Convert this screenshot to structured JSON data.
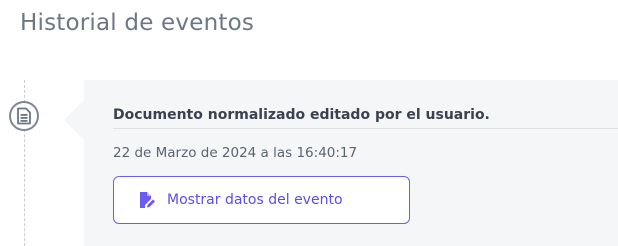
{
  "page": {
    "title": "Historial de eventos"
  },
  "events": [
    {
      "icon": "document-icon",
      "title": "Documento normalizado editado por el usuario.",
      "timestamp": "22 de Marzo de 2024 a las 16:40:17",
      "button": {
        "label": "Mostrar datos del evento",
        "icon": "file-edit-icon"
      }
    }
  ],
  "colors": {
    "accent": "#6a5cf0",
    "title": "#6b7785",
    "card_bg": "#f5f6f7"
  }
}
